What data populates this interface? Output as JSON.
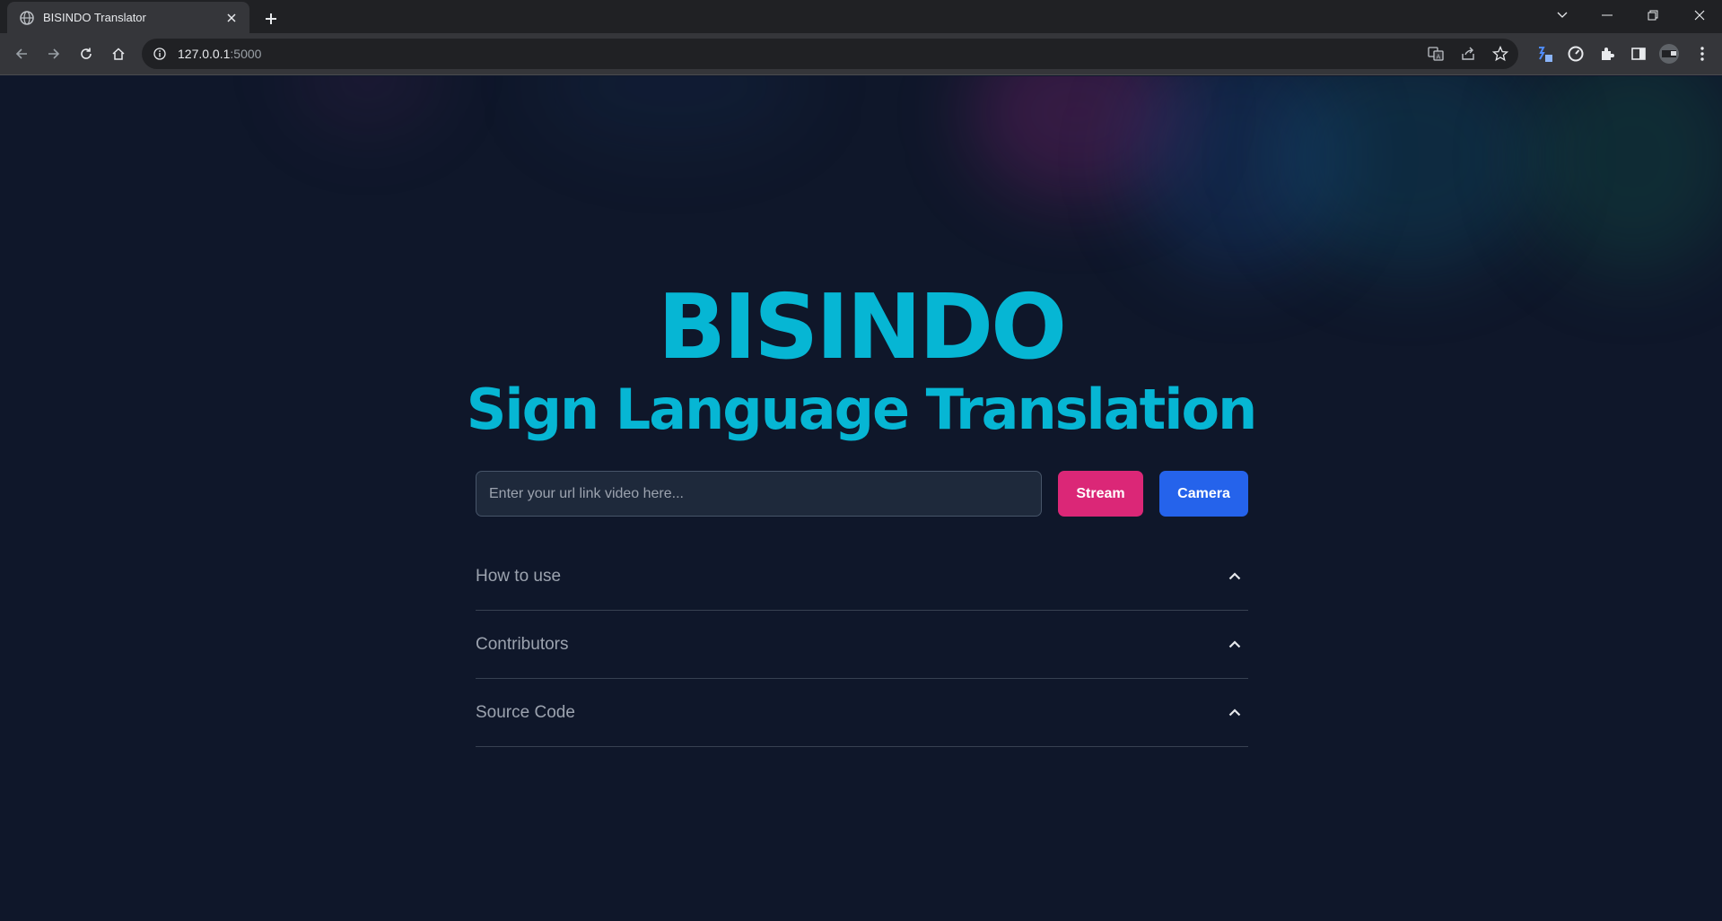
{
  "browser": {
    "tab_title": "BISINDO Translator",
    "url_host": "127.0.0.1",
    "url_port": ":5000"
  },
  "icons": {
    "favicon": "globe-icon",
    "tab_close": "close-icon",
    "new_tab": "plus-icon",
    "back": "arrow-left-icon",
    "forward": "arrow-right-icon",
    "reload": "reload-icon",
    "home": "home-icon",
    "site_info": "info-icon",
    "translate": "translate-icon",
    "share": "share-icon",
    "bookmark": "star-icon",
    "extensions": "puzzle-icon",
    "side_panel": "side-panel-icon",
    "menu": "more-vertical-icon"
  },
  "hero": {
    "title": "BISINDO",
    "subtitle": "Sign Language Translation"
  },
  "search": {
    "placeholder": "Enter your url link video here...",
    "value": ""
  },
  "buttons": {
    "stream_label": "Stream",
    "camera_label": "Camera"
  },
  "accordion": {
    "items": [
      {
        "label": "How to use"
      },
      {
        "label": "Contributors"
      },
      {
        "label": "Source Code"
      }
    ]
  },
  "colors": {
    "background": "#0f172a",
    "title": "#06b6d4",
    "stream": "#db2777",
    "camera": "#2563eb"
  }
}
